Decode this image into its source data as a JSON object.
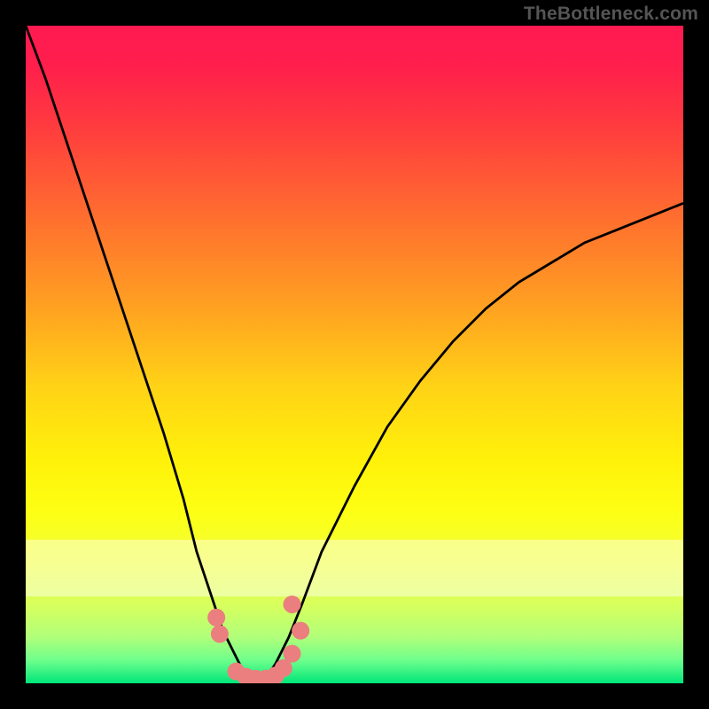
{
  "watermark": "TheBottleneck.com",
  "chart_data": {
    "type": "line",
    "title": "",
    "xlabel": "",
    "ylabel": "",
    "xlim": [
      0,
      100
    ],
    "ylim": [
      0,
      100
    ],
    "grid": false,
    "series": [
      {
        "name": "left-curve",
        "x": [
          0,
          3,
          6,
          9,
          12,
          15,
          18,
          21,
          24,
          26,
          28,
          30,
          32,
          33,
          34,
          36
        ],
        "values": [
          100,
          92,
          83,
          74,
          65,
          56,
          47,
          38,
          28,
          20,
          14,
          8,
          4,
          2,
          1,
          0
        ]
      },
      {
        "name": "right-curve",
        "x": [
          36,
          38,
          40,
          42,
          45,
          50,
          55,
          60,
          65,
          70,
          75,
          80,
          85,
          90,
          95,
          100
        ],
        "values": [
          0,
          3,
          7,
          12,
          20,
          30,
          39,
          46,
          52,
          57,
          61,
          64,
          67,
          69,
          71,
          73
        ]
      },
      {
        "name": "markers",
        "marker_x": [
          29.0,
          29.5,
          32.0,
          33.5,
          35.0,
          36.5,
          38.0,
          39.2,
          40.5,
          41.8,
          40.5
        ],
        "marker_y": [
          10.0,
          7.5,
          1.8,
          1.0,
          0.7,
          0.7,
          1.2,
          2.3,
          4.5,
          8.0,
          12.0
        ]
      }
    ],
    "gradient_stops": [
      {
        "pos": 0.0,
        "color": "#ff1a51"
      },
      {
        "pos": 0.06,
        "color": "#ff1e4c"
      },
      {
        "pos": 0.15,
        "color": "#ff3a3f"
      },
      {
        "pos": 0.28,
        "color": "#ff6a30"
      },
      {
        "pos": 0.42,
        "color": "#ff9e22"
      },
      {
        "pos": 0.55,
        "color": "#ffd316"
      },
      {
        "pos": 0.66,
        "color": "#fff10a"
      },
      {
        "pos": 0.74,
        "color": "#fdff14"
      },
      {
        "pos": 0.82,
        "color": "#f0ff3a"
      },
      {
        "pos": 0.88,
        "color": "#d8ff5d"
      },
      {
        "pos": 0.93,
        "color": "#b0ff7a"
      },
      {
        "pos": 0.965,
        "color": "#6eff8c"
      },
      {
        "pos": 1.0,
        "color": "#00e67a"
      }
    ],
    "white_band": {
      "top_frac": 0.782,
      "height_frac": 0.086
    },
    "marker_color": "#eb7e7e",
    "curve_color": "#000000"
  }
}
